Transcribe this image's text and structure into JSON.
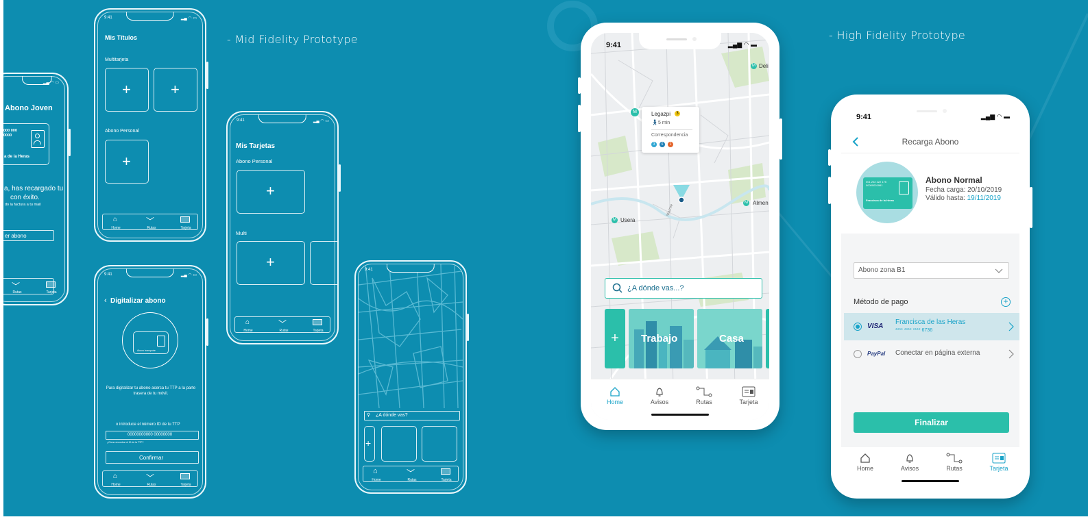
{
  "captions": {
    "mid": "- Mid Fidelity Prototype",
    "high": "- High Fidelity Prototype"
  },
  "status": {
    "time": "9:41"
  },
  "wf_joven": {
    "title": "Abono Joven",
    "card_number": "000 000\n0000",
    "card_holder": "a de la Heras",
    "message_line1": "a, has recargado tu",
    "message_line2": "con éxito.",
    "message_small": "do la factura a tu mail",
    "button": "er abono",
    "nav": [
      "Rutas",
      "Tarjeta"
    ]
  },
  "wf_titulos": {
    "title": "Mis Títulos",
    "section1": "Multitarjeta",
    "section2": "Abono Personal",
    "nav": [
      "Home",
      "Rutas",
      "Tarjeta"
    ]
  },
  "wf_tarjetas": {
    "title": "Mis Tarjetas",
    "section1": "Abono Personal",
    "section2": "Multi",
    "nav": [
      "Home",
      "Rutas",
      "Tarjeta"
    ]
  },
  "wf_digitalizar": {
    "title": "Digitalizar abono",
    "card_label": "Abono transporte",
    "instruction": "Para digitalizar tu abono acerca tu TTP a la parte trasera de tu móvil.",
    "alt_text": "o introduce el número ID de tu TTP",
    "id_value": "00000000000 00000000",
    "help": "¿Cómo encontrar el ID de la TTP?",
    "confirm": "Confirmar",
    "nav": [
      "Home",
      "Rutas",
      "Tarjeta"
    ]
  },
  "wf_map": {
    "search": "¿A dónde vas?",
    "nav": [
      "Home",
      "Rutas",
      "Tarjeta"
    ]
  },
  "hf_map": {
    "labels": {
      "deli": "Deli",
      "almen": "Almen",
      "usera": "Usera",
      "street": "Marme"
    },
    "popup": {
      "station": "Legazpi",
      "line": "3",
      "walk": "5 min",
      "corr": "Correspondencia",
      "corr_lines": [
        "3",
        "6",
        "1"
      ]
    },
    "search_placeholder": "¿A dónde vas...?",
    "cards": [
      "Trabajo",
      "Casa"
    ],
    "nav": [
      "Home",
      "Avisos",
      "Rutas",
      "Tarjeta"
    ]
  },
  "hf_recarga": {
    "header": "Recarga Abono",
    "card_number": "001 202 222 175\n00000001961",
    "card_holder": "Francisca de la Heras",
    "abono_title": "Abono Normal",
    "fecha_label": "Fecha carga:",
    "fecha_value": "20/10/2019",
    "valido_label": "Válido hasta:",
    "valido_value": "19/11/2019",
    "zone_select": "Abono zona B1",
    "payment_title": "Método de pago",
    "visa_brand": "VISA",
    "visa_name": "Francisca de las Heras",
    "visa_number": "**** **** **** 6736",
    "paypal_brand": "PayPal",
    "paypal_text": "Conectar en página externa",
    "finish": "Finalizar",
    "nav": [
      "Home",
      "Avisos",
      "Rutas",
      "Tarjeta"
    ]
  },
  "colors": {
    "bg": "#0d8db0",
    "teal": "#2bbfaa",
    "accent": "#19a3c8"
  }
}
